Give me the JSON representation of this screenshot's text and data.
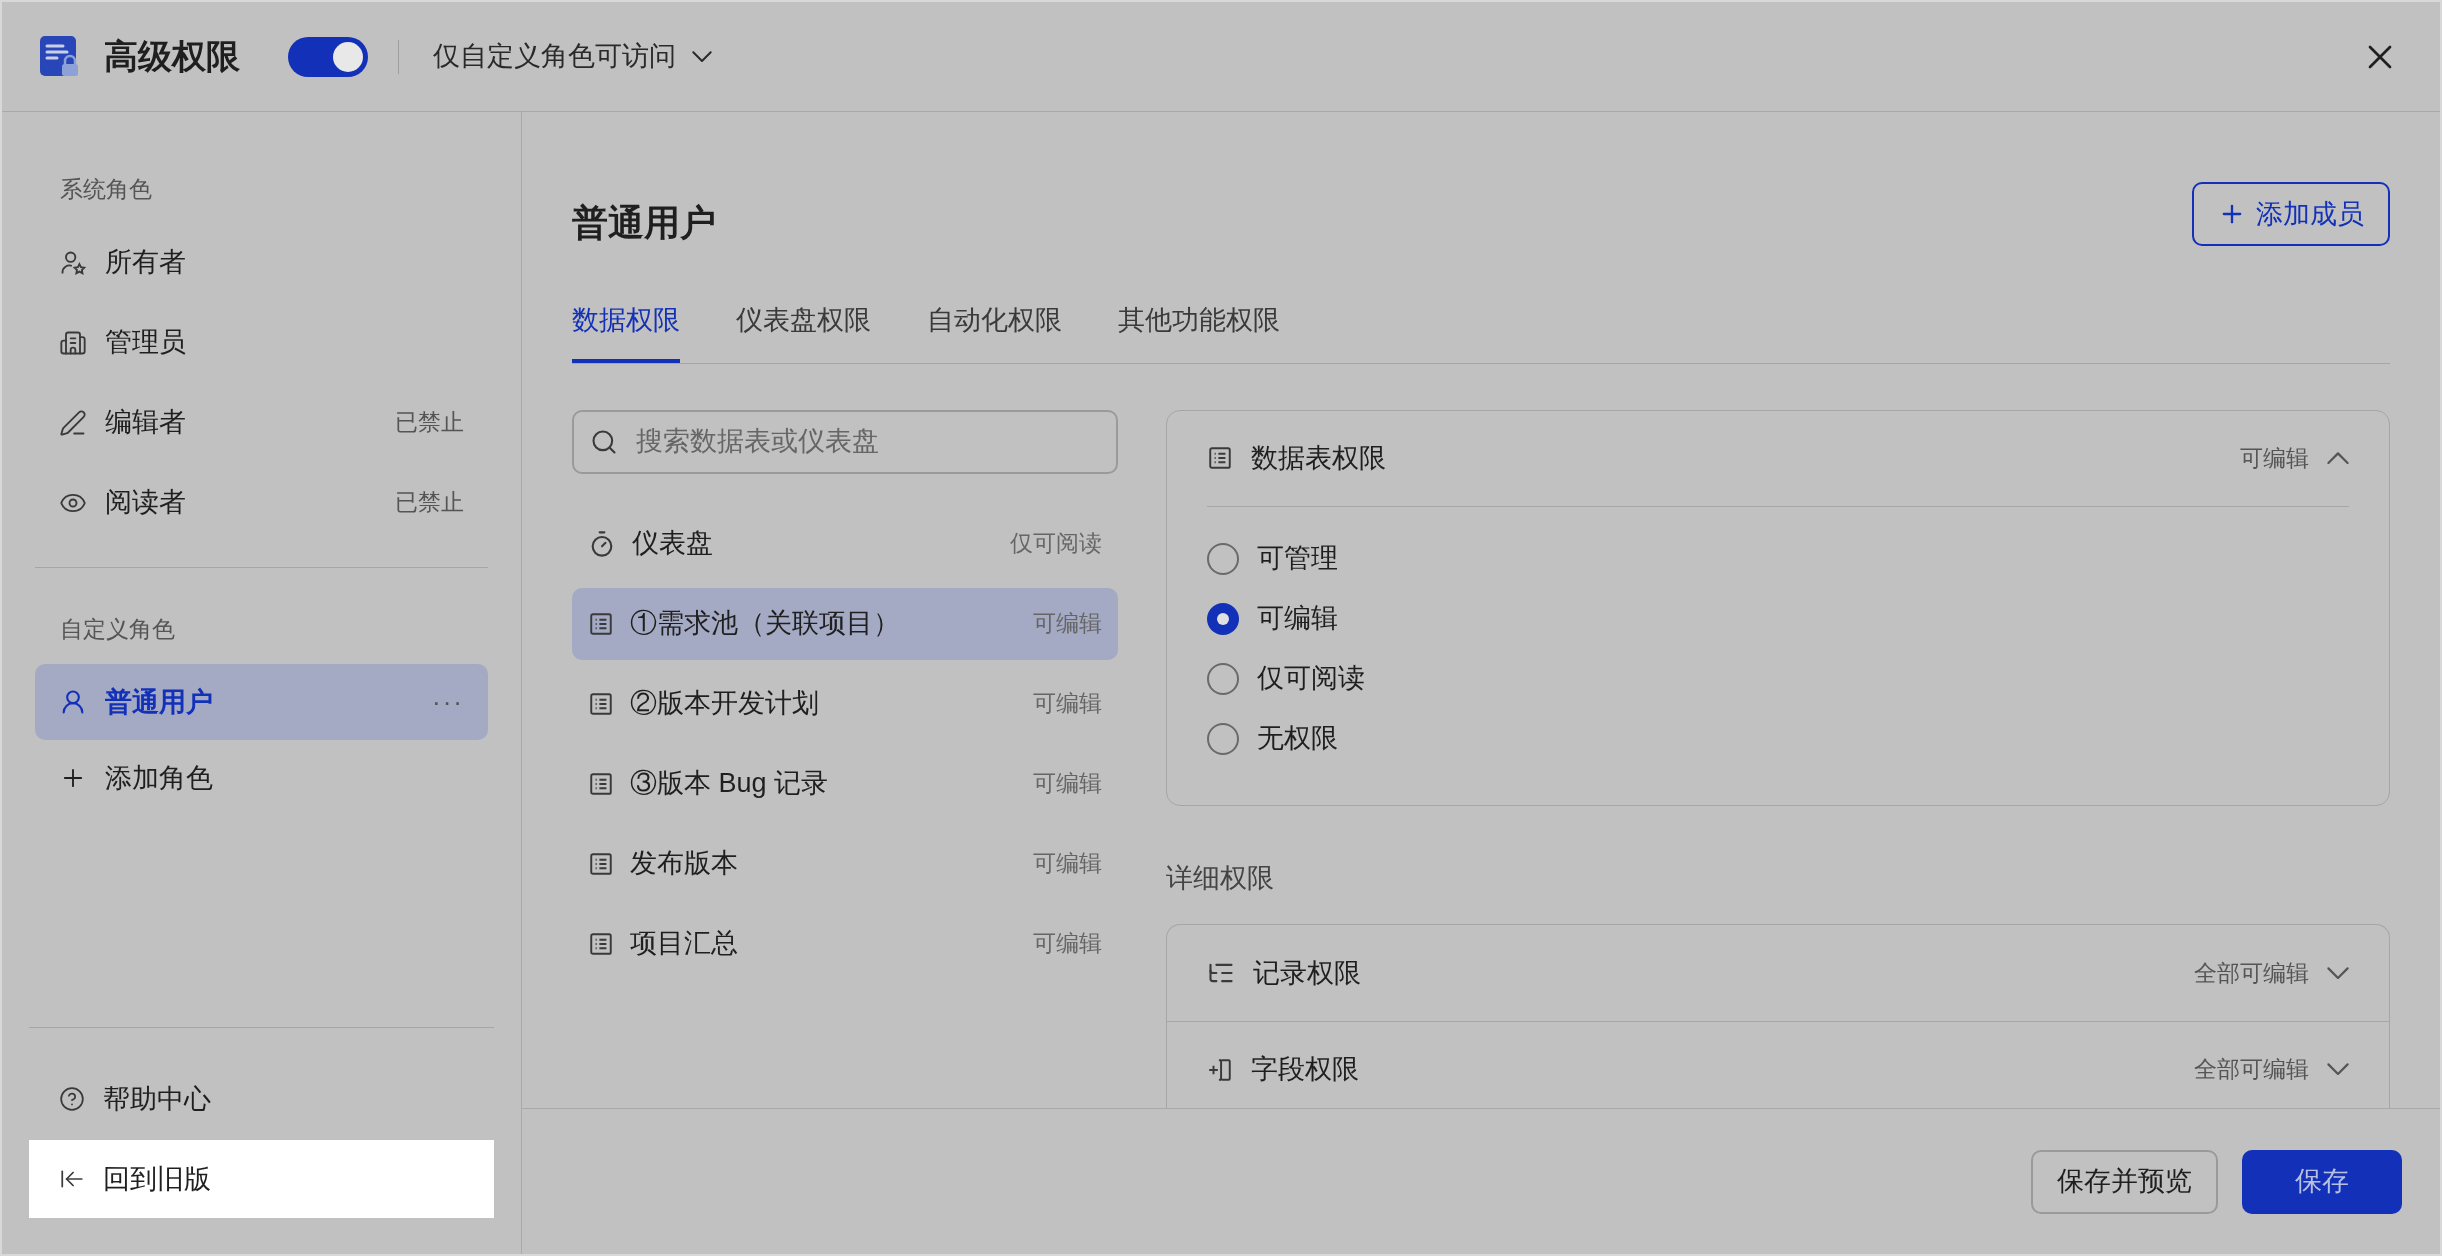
{
  "header": {
    "title": "高级权限",
    "toggle": {
      "on": true
    },
    "access": {
      "label": "仅自定义角色可访问"
    }
  },
  "sidebar": {
    "sections": [
      {
        "heading": "系统角色",
        "items": [
          {
            "kind": "owner",
            "label": "所有者",
            "selected": false
          },
          {
            "kind": "admin",
            "label": "管理员",
            "selected": false
          },
          {
            "kind": "editor",
            "label": "编辑者",
            "status": "已禁止",
            "selected": false
          },
          {
            "kind": "reader",
            "label": "阅读者",
            "status": "已禁止",
            "selected": false
          }
        ]
      },
      {
        "heading": "自定义角色",
        "items": [
          {
            "kind": "user",
            "label": "普通用户",
            "selected": true,
            "more": "···"
          }
        ]
      }
    ],
    "add_role": "添加角色",
    "footer": [
      {
        "kind": "help",
        "label": "帮助中心",
        "highlighted": false
      },
      {
        "kind": "back",
        "label": "回到旧版",
        "highlighted": true
      }
    ]
  },
  "main": {
    "title": "普通用户",
    "add_member": "添加成员",
    "tabs": [
      {
        "label": "数据权限",
        "selected": true
      },
      {
        "label": "仪表盘权限",
        "selected": false
      },
      {
        "label": "自动化权限",
        "selected": false
      },
      {
        "label": "其他功能权限",
        "selected": false
      }
    ],
    "search": {
      "placeholder": "搜索数据表或仪表盘"
    },
    "tables": [
      {
        "kind": "dashboard",
        "label": "仪表盘",
        "permission": "仅可阅读",
        "selected": false
      },
      {
        "kind": "table",
        "label": "①需求池（关联项目）",
        "permission": "可编辑",
        "selected": true
      },
      {
        "kind": "table",
        "label": "②版本开发计划",
        "permission": "可编辑",
        "selected": false
      },
      {
        "kind": "table",
        "label": "③版本 Bug 记录",
        "permission": "可编辑",
        "selected": false
      },
      {
        "kind": "table",
        "label": "发布版本",
        "permission": "可编辑",
        "selected": false
      },
      {
        "kind": "table",
        "label": "项目汇总",
        "permission": "可编辑",
        "selected": false
      }
    ],
    "table_permission": {
      "title": "数据表权限",
      "value": "可编辑",
      "expanded": true,
      "options": [
        {
          "label": "可管理",
          "selected": false
        },
        {
          "label": "可编辑",
          "selected": true
        },
        {
          "label": "仅可阅读",
          "selected": false
        },
        {
          "label": "无权限",
          "selected": false
        }
      ]
    },
    "details": {
      "heading": "详细权限",
      "rows": [
        {
          "kind": "records",
          "label": "记录权限",
          "value": "全部可编辑",
          "expanded": false
        },
        {
          "kind": "fields",
          "label": "字段权限",
          "value": "全部可编辑",
          "expanded": false
        }
      ]
    }
  },
  "buttons": [
    {
      "kind": "secondary",
      "label": "保存并预览"
    },
    {
      "kind": "primary",
      "label": "保存"
    }
  ]
}
